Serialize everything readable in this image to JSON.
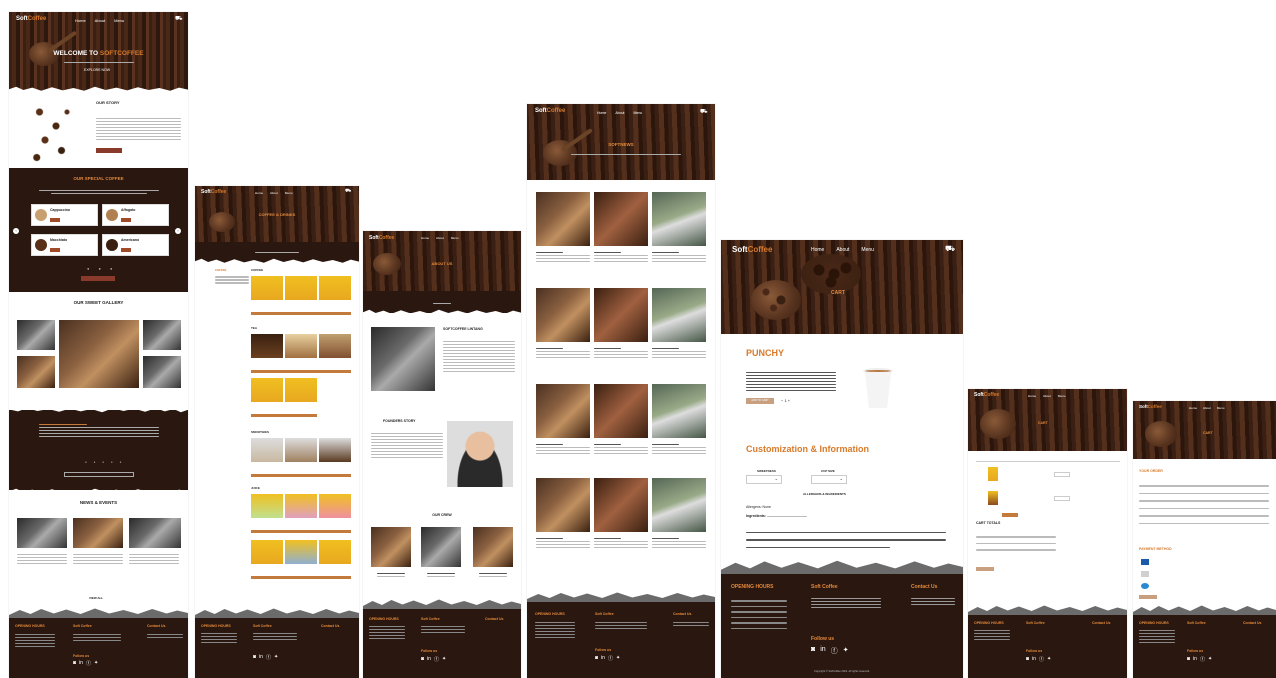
{
  "brand": {
    "left": "Soft",
    "right": "Coffee"
  },
  "nav": {
    "home": "Home",
    "about": "About",
    "menu": "Menu"
  },
  "home": {
    "hero_title_a": "WELCOME TO",
    "hero_title_b": "SOFTCOFFEE",
    "hero_button": "EXPLORE NOW",
    "story_title": "OUR STORY",
    "special_title": "OUR SPECIAL COFFEE",
    "specials": [
      "Cappuccino",
      "Affogato",
      "Macchiato",
      "Americano"
    ],
    "gallery_title": "OUR SWEET GALLERY",
    "news_title": "NEWS & EVENTS",
    "view_all": "VIEW ALL"
  },
  "menu_page": {
    "hero_title": "COFFEE & DRINKS",
    "sections": [
      "COFFEE",
      "TEA",
      "SMOOTHIES",
      "JUICE"
    ]
  },
  "about_page": {
    "hero_title": "ABOUT US",
    "story_title": "SOFTCOFFEE LINTANG",
    "founder_title": "FOUNDERS STORY",
    "crew_title": "OUR CREW"
  },
  "news_page": {
    "hero_title": "SOFTNEWS"
  },
  "product_page": {
    "hero_title": "CART",
    "product_name": "PUNCHY",
    "add_button": "ADD TO CART",
    "custom_title": "Customization & Information",
    "sweetness_label": "SWEETNESS",
    "size_label": "CUP SIZE",
    "allergens_label": "ALLERGENS & INGREDIENTS",
    "allergens": "Allergens: None",
    "ingredients": "Ingredients:",
    "copyright": "Copyright © SoftCoffee 2022. All rights reserved."
  },
  "cart_page": {
    "hero_title": "CART",
    "totals_title": "CART TOTALS"
  },
  "checkout_page": {
    "hero_title": "CART",
    "your_order": "YOUR ORDER",
    "payment": "PAYMENT METHOD"
  },
  "footer": {
    "hours_title": "OPENING HOURS",
    "about_title": "Soft Coffee",
    "contact_title": "Contact Us",
    "follow_title": "Follow us"
  },
  "colors": {
    "accent": "#d87a2a",
    "dark": "#2a1710"
  }
}
